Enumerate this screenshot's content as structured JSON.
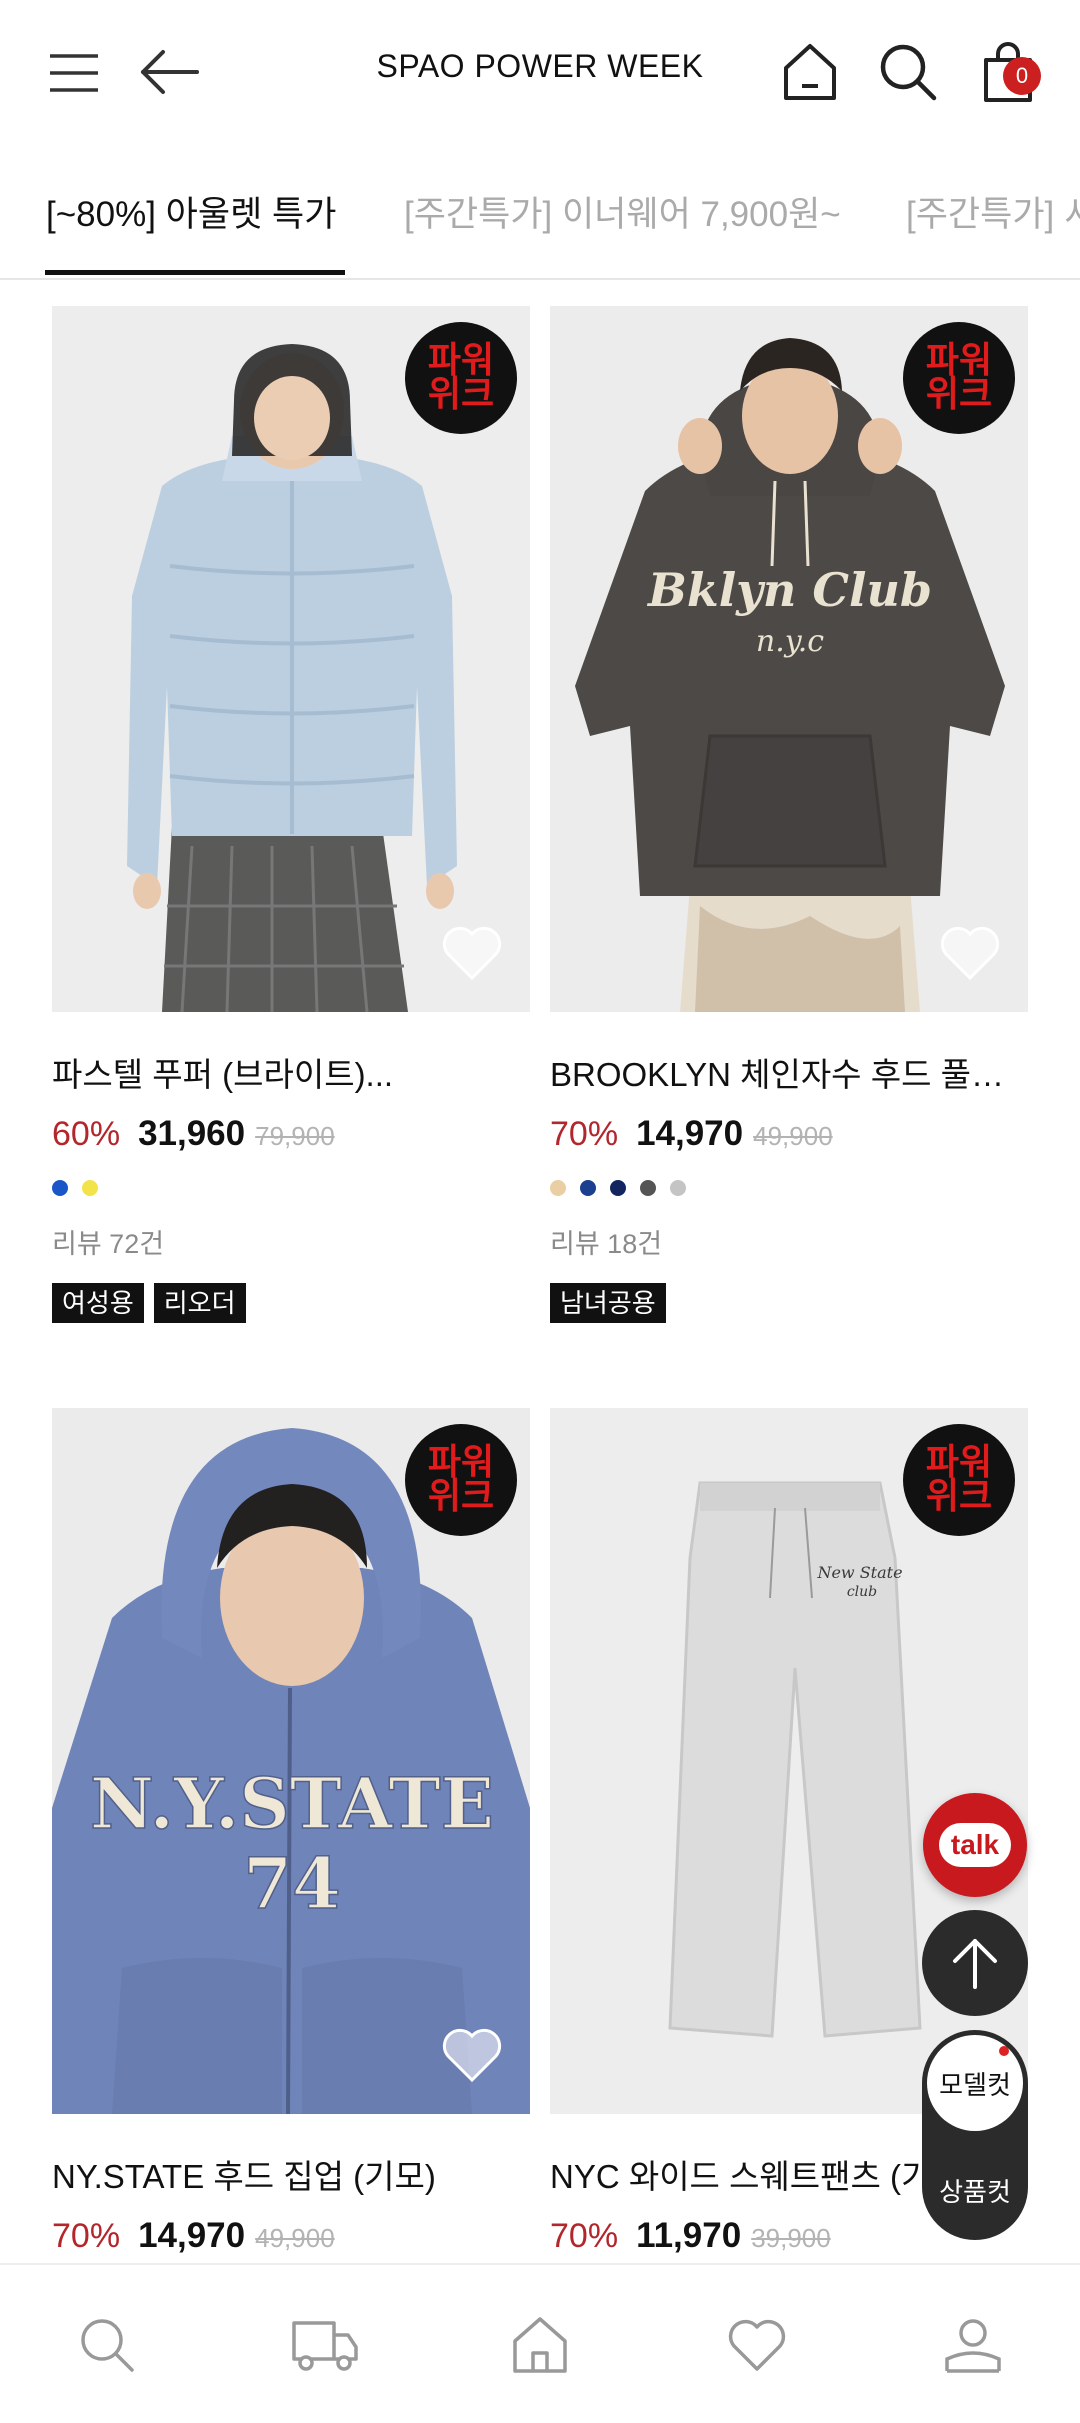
{
  "header": {
    "title": "SPAO POWER WEEK",
    "cart_count": "0",
    "icons": [
      "menu-icon",
      "back-arrow-icon",
      "home-icon",
      "search-icon",
      "shopping-bag-icon"
    ]
  },
  "tabs": [
    {
      "label": "[~80%] 아울렛 특가",
      "active": true
    },
    {
      "label": "[주간특가] 이너웨어 7,900원~",
      "active": false
    },
    {
      "label": "[주간특가] 셔",
      "active": false
    }
  ],
  "badge": {
    "line1": "파워",
    "line2": "위크"
  },
  "products": [
    {
      "name": "파스텔 푸퍼 (브라이트)...",
      "discount": "60%",
      "price": "31,960",
      "original_price": "79,900",
      "swatches": [
        "#1a56c8",
        "#f3e34a"
      ],
      "review": "리뷰 72건",
      "tags": [
        "여성용",
        "리오더"
      ]
    },
    {
      "name": "BROOKLYN 체인자수 후드 풀오...",
      "discount": "70%",
      "price": "14,970",
      "original_price": "49,900",
      "swatches": [
        "#e9cfa3",
        "#1c3f8f",
        "#13255e",
        "#555555",
        "#c4c4c4"
      ],
      "review": "리뷰 18건",
      "tags": [
        "남녀공용"
      ]
    },
    {
      "name": "NY.STATE 후드 집업 (기모)",
      "discount": "70%",
      "price": "14,970",
      "original_price": "49,900"
    },
    {
      "name": "NYC 와이드 스웨트팬츠 (기모)",
      "discount": "70%",
      "price": "11,970",
      "original_price": "39,900"
    }
  ],
  "floating": {
    "talk": "talk",
    "model_cut": "모델컷",
    "product_cut": "상품컷"
  },
  "bottom_nav": [
    "search-icon",
    "delivery-truck-icon",
    "home-icon",
    "heart-icon",
    "user-icon"
  ],
  "colors": {
    "accent": "#b3262b",
    "badge_red": "#e11b1b",
    "dark": "#2b2b2b"
  }
}
